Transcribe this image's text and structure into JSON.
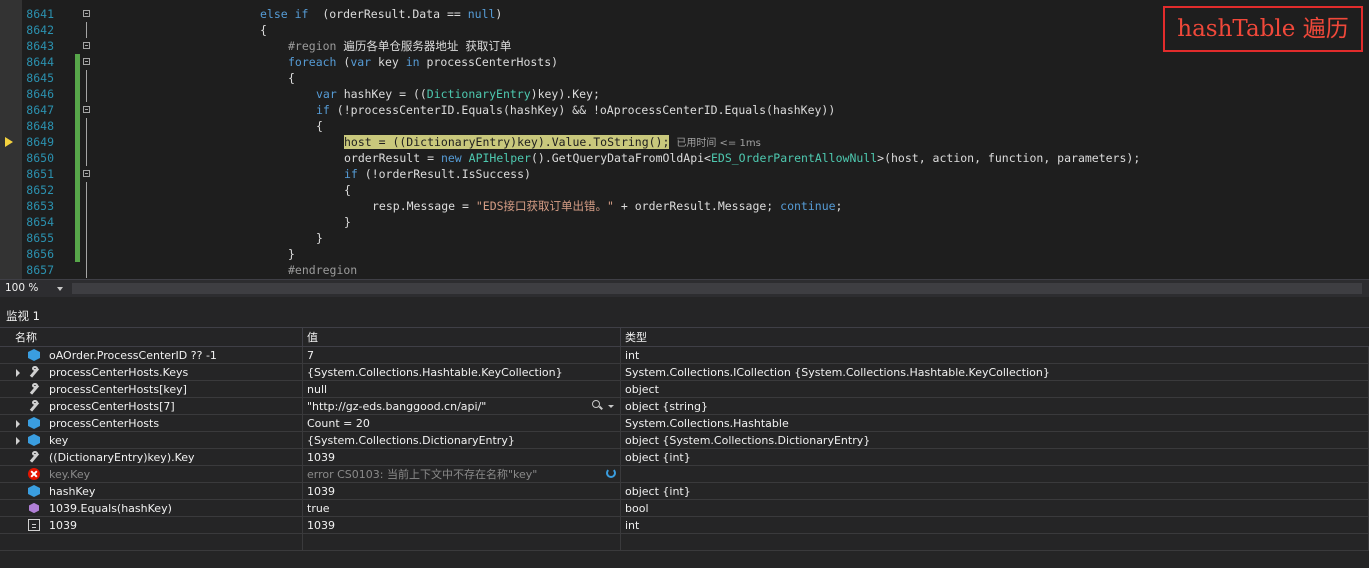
{
  "annotation": {
    "text": "hashTable 遍历"
  },
  "editor": {
    "lines": [
      {
        "n": "8641",
        "indent": 6,
        "parts": [
          [
            "kw",
            "else if"
          ],
          [
            "",
            "  (orderResult.Data == "
          ],
          [
            "kw",
            "null"
          ],
          [
            "",
            ")"
          ]
        ]
      },
      {
        "n": "8642",
        "indent": 6,
        "parts": [
          [
            "",
            "{"
          ]
        ]
      },
      {
        "n": "8643",
        "indent": 7,
        "parts": [
          [
            "cm",
            "#region"
          ],
          [
            "",
            " 遍历各单仓服务器地址 获取订单"
          ]
        ]
      },
      {
        "n": "8644",
        "indent": 7,
        "parts": [
          [
            "kw",
            "foreach"
          ],
          [
            "",
            " ("
          ],
          [
            "kw",
            "var"
          ],
          [
            "",
            " key "
          ],
          [
            "kw",
            "in"
          ],
          [
            "",
            " processCenterHosts)"
          ]
        ]
      },
      {
        "n": "8645",
        "indent": 7,
        "parts": [
          [
            "",
            "{"
          ]
        ]
      },
      {
        "n": "8646",
        "indent": 8,
        "parts": [
          [
            "kw",
            "var"
          ],
          [
            "",
            " hashKey = (("
          ],
          [
            "ty",
            "DictionaryEntry"
          ],
          [
            "",
            ")key).Key;"
          ]
        ]
      },
      {
        "n": "8647",
        "indent": 8,
        "parts": [
          [
            "kw",
            "if"
          ],
          [
            "",
            " (!processCenterID.Equals(hashKey) && !oAprocessCenterID.Equals(hashKey))"
          ]
        ]
      },
      {
        "n": "8648",
        "indent": 8,
        "parts": [
          [
            "",
            "{"
          ]
        ]
      },
      {
        "n": "8649",
        "indent": 9,
        "parts": [
          [
            "hl",
            "host = ((DictionaryEntry)key).Value.ToString();"
          ],
          [
            "",
            " "
          ],
          [
            "hint",
            "已用时间 <= 1ms"
          ]
        ]
      },
      {
        "n": "8650",
        "indent": 9,
        "parts": [
          [
            "",
            "orderResult = "
          ],
          [
            "kw",
            "new"
          ],
          [
            "",
            " "
          ],
          [
            "ty",
            "APIHelper"
          ],
          [
            "",
            "().GetQueryDataFromOldApi<"
          ],
          [
            "ty",
            "EDS_OrderParentAllowNull"
          ],
          [
            "",
            ">(host, action, function, parameters);"
          ]
        ]
      },
      {
        "n": "8651",
        "indent": 9,
        "parts": [
          [
            "kw",
            "if"
          ],
          [
            "",
            " (!orderResult.IsSuccess)"
          ]
        ]
      },
      {
        "n": "8652",
        "indent": 9,
        "parts": [
          [
            "",
            "{"
          ]
        ]
      },
      {
        "n": "8653",
        "indent": 10,
        "parts": [
          [
            "",
            "resp.Message = "
          ],
          [
            "str",
            "\"EDS接口获取订单出错。\""
          ],
          [
            "",
            " + orderResult.Message; "
          ],
          [
            "kw",
            "continue"
          ],
          [
            "",
            ";"
          ]
        ]
      },
      {
        "n": "8654",
        "indent": 9,
        "parts": [
          [
            "",
            "}"
          ]
        ]
      },
      {
        "n": "8655",
        "indent": 8,
        "parts": [
          [
            "",
            "}"
          ]
        ]
      },
      {
        "n": "8656",
        "indent": 7,
        "parts": [
          [
            "",
            "}"
          ]
        ]
      },
      {
        "n": "8657",
        "indent": 7,
        "parts": [
          [
            "cm",
            "#endregion"
          ]
        ]
      }
    ],
    "zoom": "100 %"
  },
  "watch": {
    "title": "监视 1",
    "headers": {
      "name": "名称",
      "value": "值",
      "type": "类型"
    },
    "rows": [
      {
        "icon": "cube-icon",
        "expand": false,
        "name": "oAOrder.ProcessCenterID ?? -1",
        "value": "7",
        "type": "int"
      },
      {
        "icon": "wrench-icon",
        "expand": true,
        "name": "processCenterHosts.Keys",
        "value": "{System.Collections.Hashtable.KeyCollection}",
        "type": "System.Collections.ICollection {System.Collections.Hashtable.KeyCollection}"
      },
      {
        "icon": "wrench-icon",
        "expand": false,
        "name": "processCenterHosts[key]",
        "value": "null",
        "type": "object"
      },
      {
        "icon": "wrench-icon",
        "expand": false,
        "name": "processCenterHosts[7]",
        "value": "\"http://gz-eds.banggood.cn/api/\"",
        "type": "object {string}",
        "magnifier": true
      },
      {
        "icon": "cube-icon",
        "expand": true,
        "name": "processCenterHosts",
        "value": "Count = 20",
        "type": "System.Collections.Hashtable"
      },
      {
        "icon": "cube-icon",
        "expand": true,
        "name": "key",
        "value": "{System.Collections.DictionaryEntry}",
        "type": "object {System.Collections.DictionaryEntry}"
      },
      {
        "icon": "wrench-icon",
        "expand": false,
        "name": "((DictionaryEntry)key).Key",
        "value": "1039",
        "type": "object {int}"
      },
      {
        "icon": "error-icon",
        "expand": false,
        "name": "key.Key",
        "value": "error CS0103: 当前上下文中不存在名称\"key\"",
        "type": "",
        "muted": true,
        "refresh": true
      },
      {
        "icon": "cube-icon",
        "expand": false,
        "name": "hashKey",
        "value": "1039",
        "type": "object {int}"
      },
      {
        "icon": "method-icon",
        "expand": false,
        "name": "1039.Equals(hashKey)",
        "value": "true",
        "type": "bool"
      },
      {
        "icon": "const-icon",
        "expand": false,
        "name": "1039",
        "value": "1039",
        "type": "int"
      }
    ],
    "colors": {
      "background": "#252526",
      "accent": "#3a9ee0"
    }
  }
}
